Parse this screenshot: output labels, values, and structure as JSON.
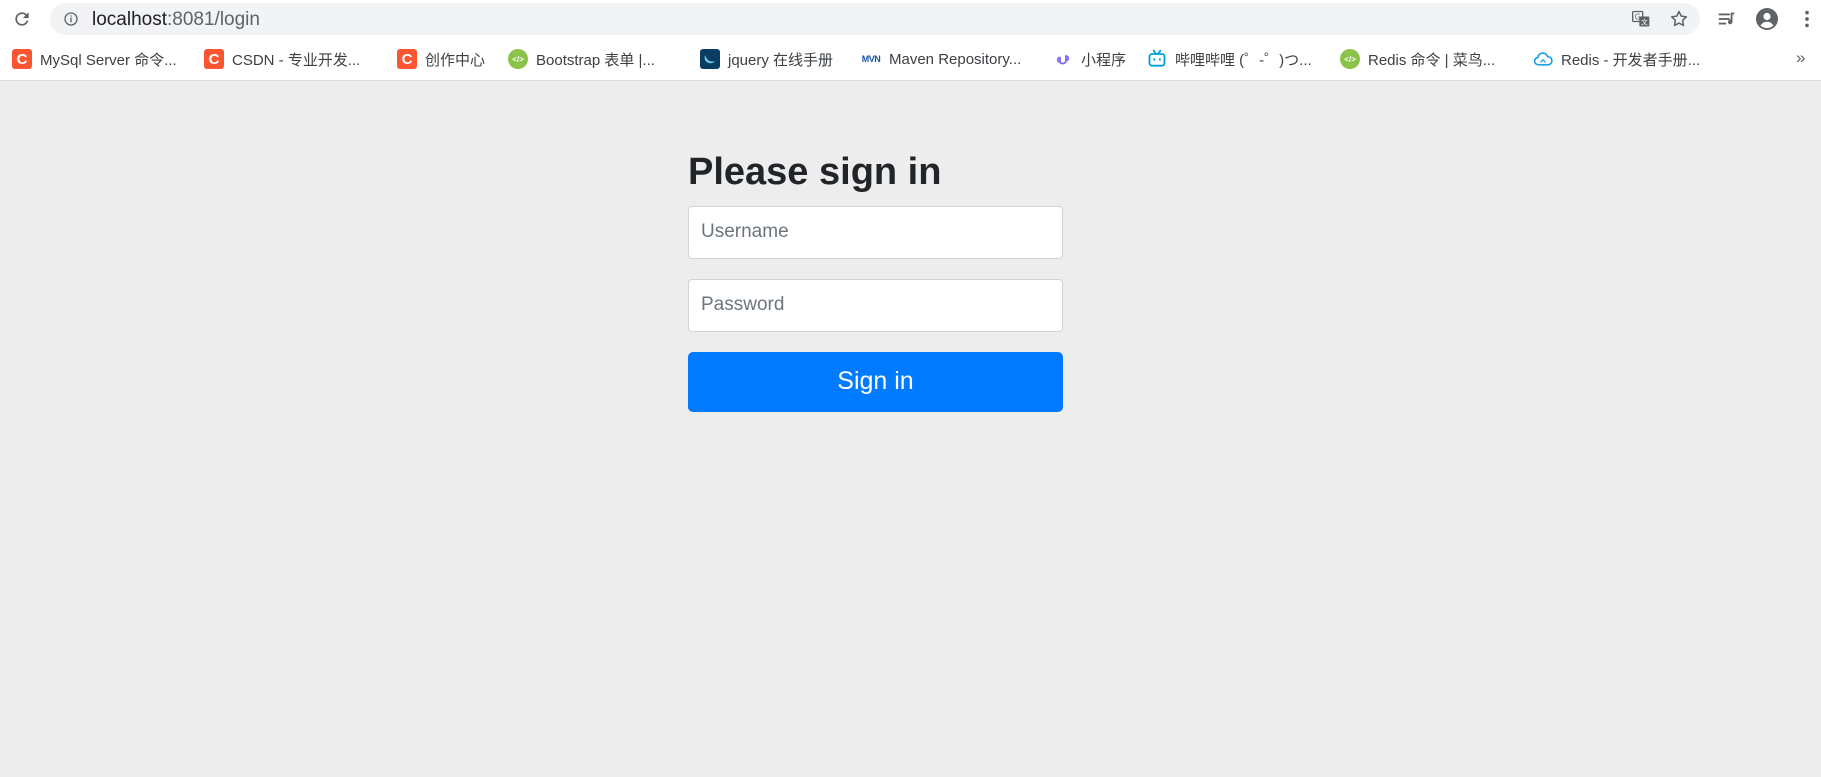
{
  "browser": {
    "url_host": "localhost",
    "url_rest": ":8081/login",
    "icons": {
      "reload": "reload-icon",
      "info": "info-icon",
      "translate": "translate-icon",
      "star": "star-icon",
      "reading_list": "reading-list-icon",
      "profile": "profile-icon",
      "menu": "kebab-menu-icon"
    }
  },
  "bookmarks": [
    {
      "label": "MySql Server 命令...",
      "icon": "csdn-icon"
    },
    {
      "label": "CSDN - 专业开发...",
      "icon": "csdn-icon"
    },
    {
      "label": "创作中心",
      "icon": "csdn-icon"
    },
    {
      "label": "Bootstrap 表单 |...",
      "icon": "runoob-icon"
    },
    {
      "label": "jquery 在线手册",
      "icon": "jquery-icon"
    },
    {
      "label": "Maven Repository...",
      "icon": "maven-icon"
    },
    {
      "label": "小程序",
      "icon": "miniprogram-icon"
    },
    {
      "label": "哔哩哔哩 (゜-゜)つ...",
      "icon": "bilibili-icon"
    },
    {
      "label": "Redis 命令 | 菜鸟...",
      "icon": "runoob-icon"
    },
    {
      "label": "Redis - 开发者手册...",
      "icon": "cloud-icon"
    }
  ],
  "bookmarks_more": "»",
  "colors": {
    "csdn": "#fc5531",
    "runoob": "#8bc34a",
    "primary": "#007bff",
    "bilibili": "#00a1d6",
    "page_bg": "#ededed"
  },
  "form": {
    "heading": "Please sign in",
    "username_placeholder": "Username",
    "password_placeholder": "Password",
    "submit_label": "Sign in"
  }
}
